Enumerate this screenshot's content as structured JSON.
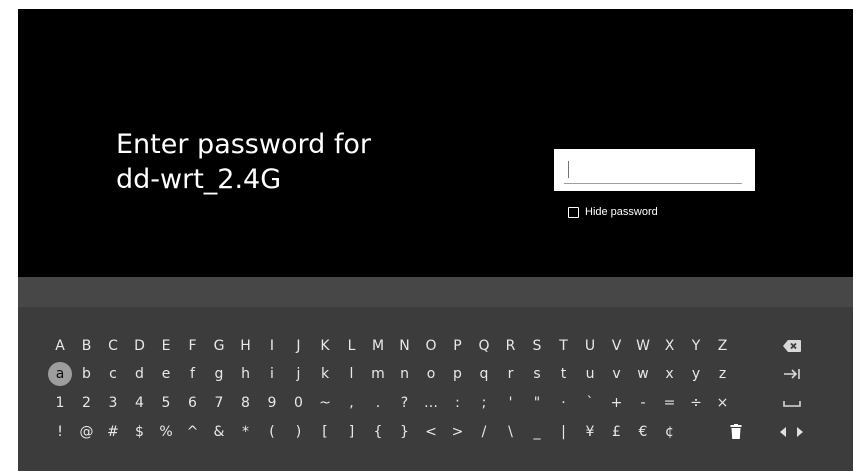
{
  "prompt": {
    "line1": "Enter password for",
    "line2": "dd-wrt_2.4G"
  },
  "password_field": {
    "value": "",
    "placeholder": ""
  },
  "hide_password": {
    "label": "Hide password",
    "checked": false
  },
  "keyboard": {
    "focused_key": "a",
    "rows": [
      [
        "A",
        "B",
        "C",
        "D",
        "E",
        "F",
        "G",
        "H",
        "I",
        "J",
        "K",
        "L",
        "M",
        "N",
        "O",
        "P",
        "Q",
        "R",
        "S",
        "T",
        "U",
        "V",
        "W",
        "X",
        "Y",
        "Z"
      ],
      [
        "a",
        "b",
        "c",
        "d",
        "e",
        "f",
        "g",
        "h",
        "i",
        "j",
        "k",
        "l",
        "m",
        "n",
        "o",
        "p",
        "q",
        "r",
        "s",
        "t",
        "u",
        "v",
        "w",
        "x",
        "y",
        "z"
      ],
      [
        "1",
        "2",
        "3",
        "4",
        "5",
        "6",
        "7",
        "8",
        "9",
        "0",
        "~",
        ",",
        ".",
        "?",
        "…",
        ":",
        ";",
        "'",
        "\"",
        "·",
        "`",
        "+",
        "-",
        "=",
        "÷",
        "×"
      ],
      [
        "!",
        "@",
        "#",
        "$",
        "%",
        "^",
        "&",
        "*",
        "(",
        ")",
        "[",
        "]",
        "{",
        "}",
        "<",
        ">",
        "/",
        "\\",
        "_",
        "|",
        "¥",
        "£",
        "€",
        "¢"
      ]
    ],
    "special_keys": [
      "backspace-icon",
      "tab-arrow-icon",
      "space-icon",
      "trash-icon",
      "arrow-left-icon",
      "arrow-right-icon"
    ]
  }
}
